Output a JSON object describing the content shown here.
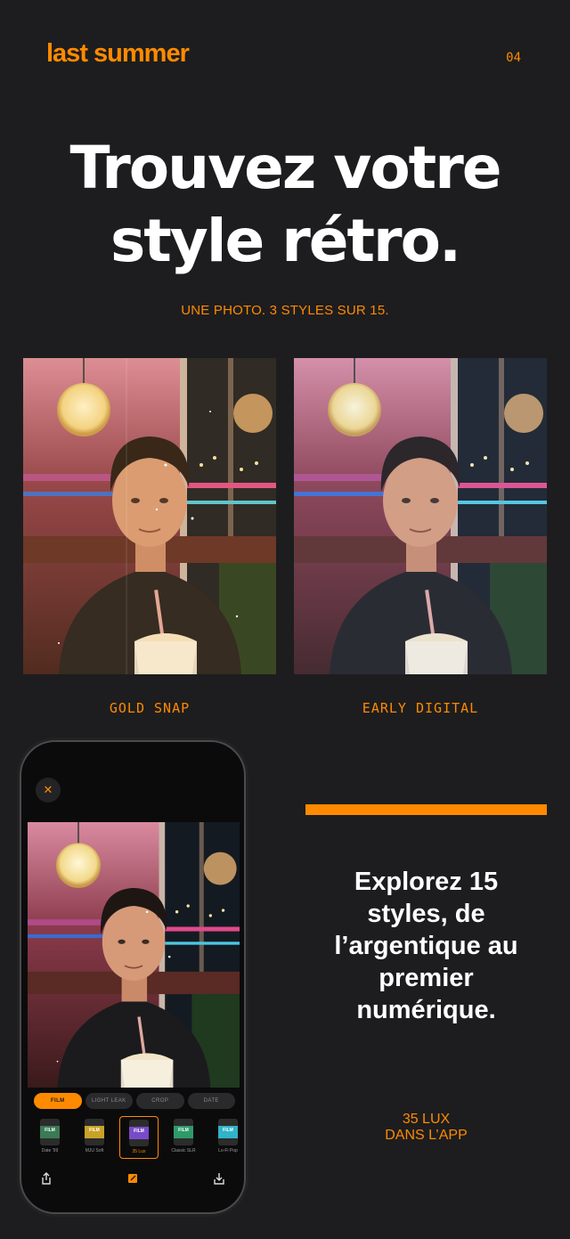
{
  "header": {
    "brand": "last summer",
    "page_number": "04"
  },
  "headline": {
    "line1": "Trouvez votre",
    "line2": "style rétro."
  },
  "subline": "UNE PHOTO. 3 STYLES SUR 15.",
  "comparisons": [
    {
      "label": "GOLD SNAP"
    },
    {
      "label": "EARLY DIGITAL"
    }
  ],
  "app": {
    "close_icon": "close-icon",
    "tabs": [
      {
        "label": "FILM",
        "active": true
      },
      {
        "label": "LIGHT LEAK",
        "active": false
      },
      {
        "label": "CROP",
        "active": false
      },
      {
        "label": "DATE",
        "active": false
      }
    ],
    "films": [
      {
        "name": "Date '99",
        "color": "#3a7a55",
        "selected": false
      },
      {
        "name": "MJU Soft",
        "color": "#c9a227",
        "selected": false
      },
      {
        "name": "35 Lux",
        "color": "#7a4bc9",
        "selected": true
      },
      {
        "name": "Classic SLR",
        "color": "#2e9a6a",
        "selected": false
      },
      {
        "name": "Lo-Fi Pop",
        "color": "#2fb4c9",
        "selected": false
      }
    ],
    "film_can_text": "FILM",
    "toolbar_icons": [
      "share-icon",
      "edit-icon",
      "download-icon"
    ]
  },
  "explore": {
    "line1": "Explorez 15",
    "line2": "styles, de",
    "line3": "l’argentique au",
    "line4": "premier",
    "line5": "numérique."
  },
  "lux": {
    "line1": "35 LUX",
    "line2": "DANS L’APP"
  },
  "colors": {
    "background": "#1d1d1f",
    "accent": "#ff8a00",
    "text": "#ffffff"
  }
}
